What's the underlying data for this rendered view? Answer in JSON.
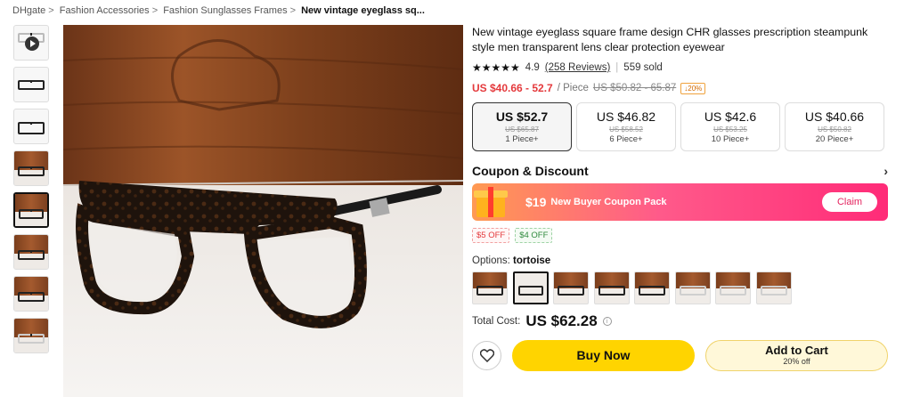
{
  "breadcrumb": {
    "items": [
      "DHgate",
      "Fashion Accessories",
      "Fashion Sunglasses Frames"
    ],
    "separator": ">",
    "current": "New vintage eyeglass sq..."
  },
  "product": {
    "title": "New vintage eyeglass square frame design CHR glasses prescription steampunk style men transparent lens clear protection eyewear",
    "rating": "4.9",
    "stars": "★★★★★",
    "reviews": "(258 Reviews)",
    "divider": "|",
    "sold": "559 sold",
    "price_range": "US $40.66 - 52.7",
    "per_piece": "/ Piece",
    "original_range": "US $50.82 - 65.87",
    "discount": "↓20%"
  },
  "tiers": [
    {
      "price": "US $52.7",
      "original": "US $65.87",
      "qty": "1 Piece+"
    },
    {
      "price": "US $46.82",
      "original": "US $58.52",
      "qty": "6 Piece+"
    },
    {
      "price": "US $42.6",
      "original": "US $53.25",
      "qty": "10 Piece+"
    },
    {
      "price": "US $40.66",
      "original": "US $50.82",
      "qty": "20 Piece+"
    }
  ],
  "coupon": {
    "heading": "Coupon & Discount",
    "chevron": "›",
    "amount": "$19",
    "text": "New Buyer Coupon Pack",
    "claim": "Claim",
    "tags": [
      "$5 OFF",
      "$4 OFF"
    ]
  },
  "options": {
    "label": "Options:",
    "selected": "tortoise"
  },
  "total": {
    "label": "Total Cost:",
    "value": "US $62.28",
    "info": "i"
  },
  "actions": {
    "buy_now": "Buy Now",
    "add_to_cart": "Add to Cart",
    "cart_discount": "20% off"
  },
  "colors": {
    "price_red": "#e4393c",
    "buy_yellow": "#ffd400",
    "coupon_pink": "#ff2b78"
  }
}
